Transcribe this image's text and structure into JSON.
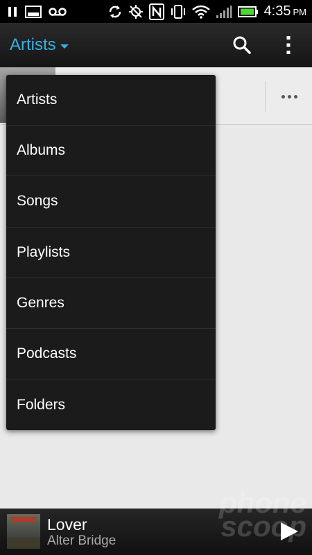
{
  "status_bar": {
    "time": "4:35",
    "ampm": "PM",
    "icons": [
      "pause-icon",
      "image-icon",
      "voicemail-icon",
      "sync-icon",
      "gps-off-icon",
      "nfc-icon",
      "vibrate-icon",
      "wifi-icon",
      "signal-icon",
      "battery-icon"
    ]
  },
  "action_bar": {
    "title": "Artists",
    "icons": [
      "search-icon",
      "overflow-menu-icon"
    ]
  },
  "menu": {
    "items": [
      {
        "label": "Artists"
      },
      {
        "label": "Albums"
      },
      {
        "label": "Songs"
      },
      {
        "label": "Playlists"
      },
      {
        "label": "Genres"
      },
      {
        "label": "Podcasts"
      },
      {
        "label": "Folders"
      }
    ]
  },
  "now_playing": {
    "title": "Lover",
    "artist": "Alter Bridge"
  },
  "watermark": "phone scoop",
  "colors": {
    "accent": "#38b0e6",
    "menu_bg": "#1b1b1b",
    "content_bg": "#e9e9e9",
    "status_bg": "#000000",
    "battery": "#4fd635"
  }
}
